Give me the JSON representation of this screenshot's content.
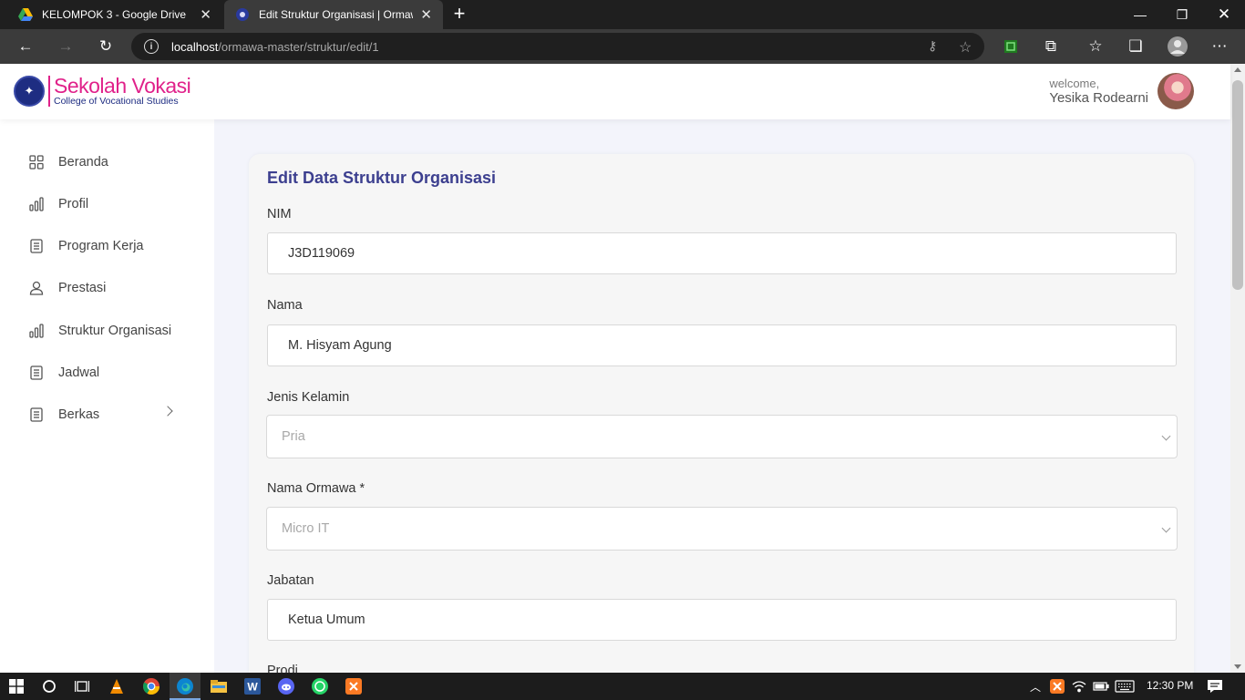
{
  "browser": {
    "tabs": [
      {
        "title": "KELOMPOK 3 - Google Drive",
        "active": false
      },
      {
        "title": "Edit Struktur Organisasi | Ormaw",
        "active": true
      }
    ],
    "url_host": "localhost",
    "url_path": "/ormawa-master/struktur/edit/1"
  },
  "header": {
    "logo_title": "Sekolah Vokasi",
    "logo_subtitle": "College of Vocational Studies",
    "welcome": "welcome,",
    "username": "Yesika Rodearni"
  },
  "sidebar": {
    "items": [
      {
        "label": "Beranda",
        "icon": "grid-icon"
      },
      {
        "label": "Profil",
        "icon": "bar-chart-icon"
      },
      {
        "label": "Program Kerja",
        "icon": "document-icon"
      },
      {
        "label": "Prestasi",
        "icon": "user-icon"
      },
      {
        "label": "Struktur Organisasi",
        "icon": "bar-chart-icon"
      },
      {
        "label": "Jadwal",
        "icon": "document-icon"
      },
      {
        "label": "Berkas",
        "icon": "document-icon",
        "has_submenu": true
      }
    ]
  },
  "form": {
    "title": "Edit Data Struktur Organisasi",
    "nim_label": "NIM",
    "nim_value": "J3D119069",
    "nama_label": "Nama",
    "nama_value": "M. Hisyam Agung",
    "jk_label": "Jenis Kelamin",
    "jk_value": "Pria",
    "ormawa_label": "Nama Ormawa *",
    "ormawa_value": "Micro IT",
    "jabatan_label": "Jabatan",
    "jabatan_value": "Ketua Umum",
    "prodi_label": "Prodi"
  },
  "taskbar": {
    "time": "12:30 PM"
  },
  "colors": {
    "accent": "#3c3f8f",
    "brand_pink": "#e0218a",
    "brand_blue": "#1e2d82",
    "content_bg": "#f3f4fb"
  }
}
